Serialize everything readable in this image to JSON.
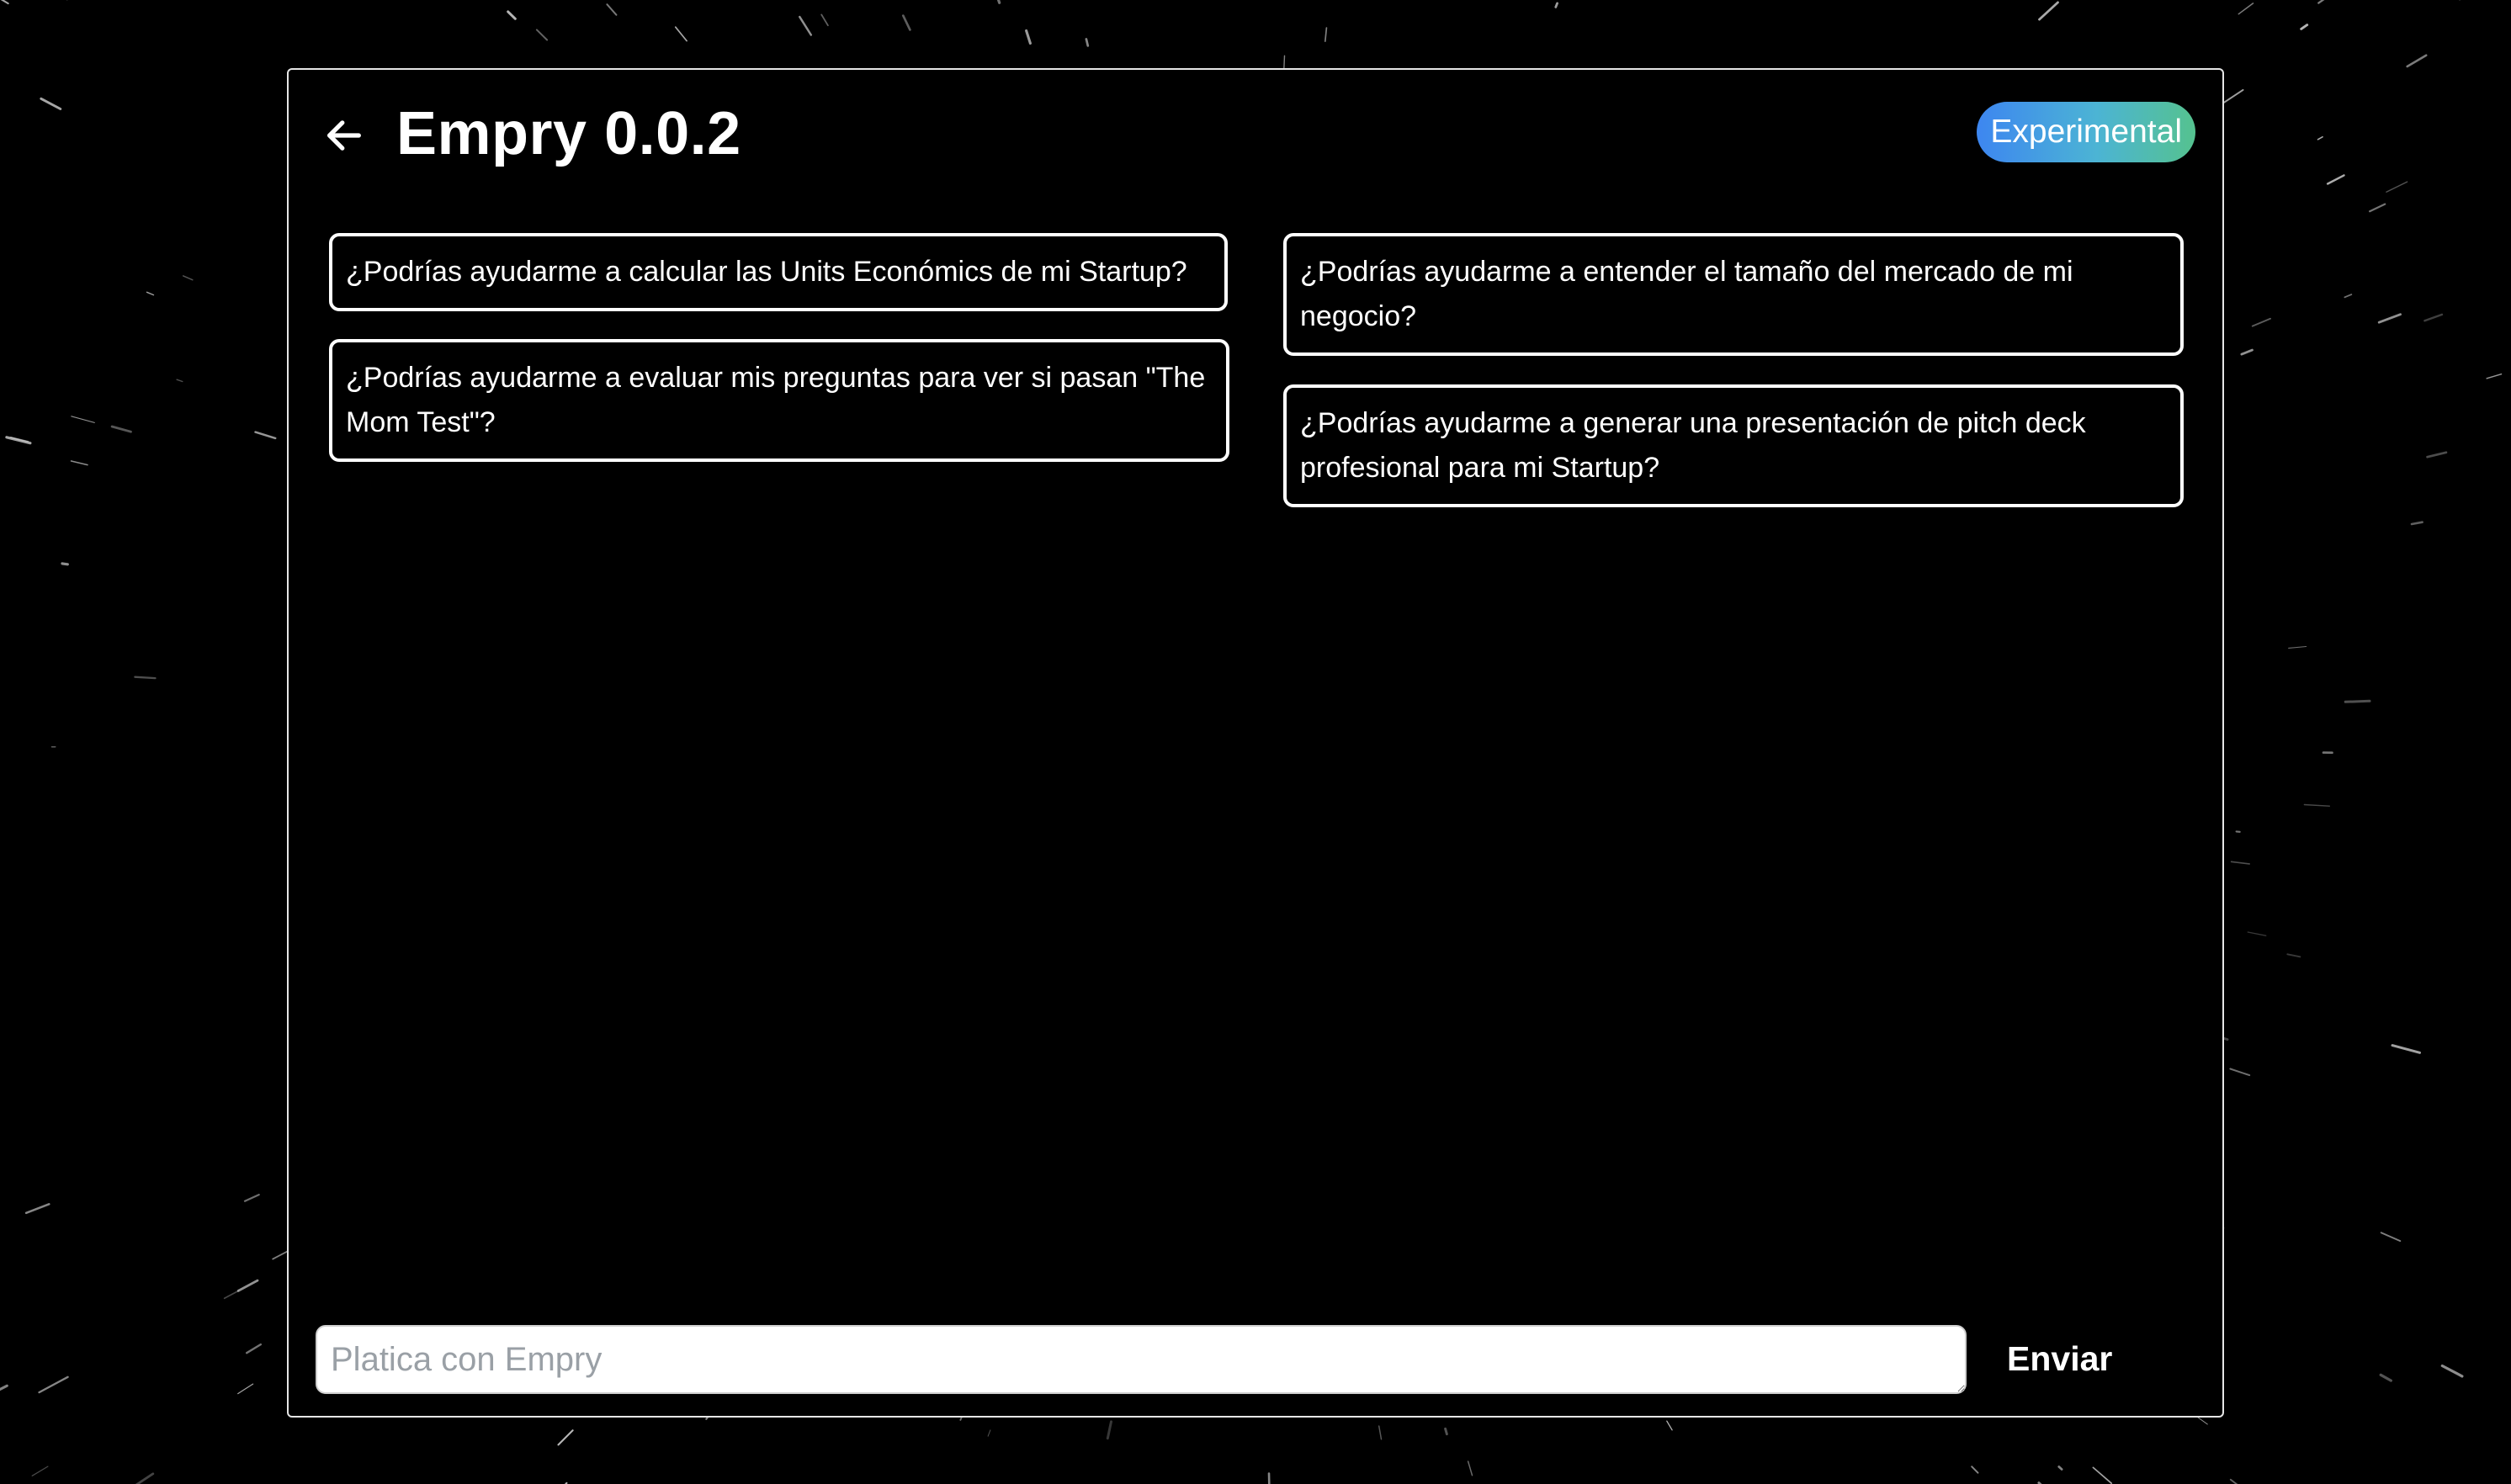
{
  "background": {
    "color": "#000000",
    "streak_color": "#d9d9d9"
  },
  "header": {
    "back_icon": "arrow-left-icon",
    "title": "Empry 0.0.2",
    "badge": "Experimental",
    "badge_gradient": [
      "#3d86f0",
      "#4cb4d4",
      "#55c28f"
    ]
  },
  "suggestions": [
    "¿Podrías ayudarme a calcular las Units Económics de mi Startup?",
    "¿Podrías ayudarme a evaluar mis preguntas para ver si pasan \"The Mom Test\"?",
    "¿Podrías ayudarme a entender el tamaño del mercado de mi negocio?",
    "¿Podrías ayudarme a generar una presentación de pitch deck profesional para mi Startup?"
  ],
  "composer": {
    "value": "",
    "placeholder": "Platica con Empry",
    "send_label": "Enviar"
  }
}
